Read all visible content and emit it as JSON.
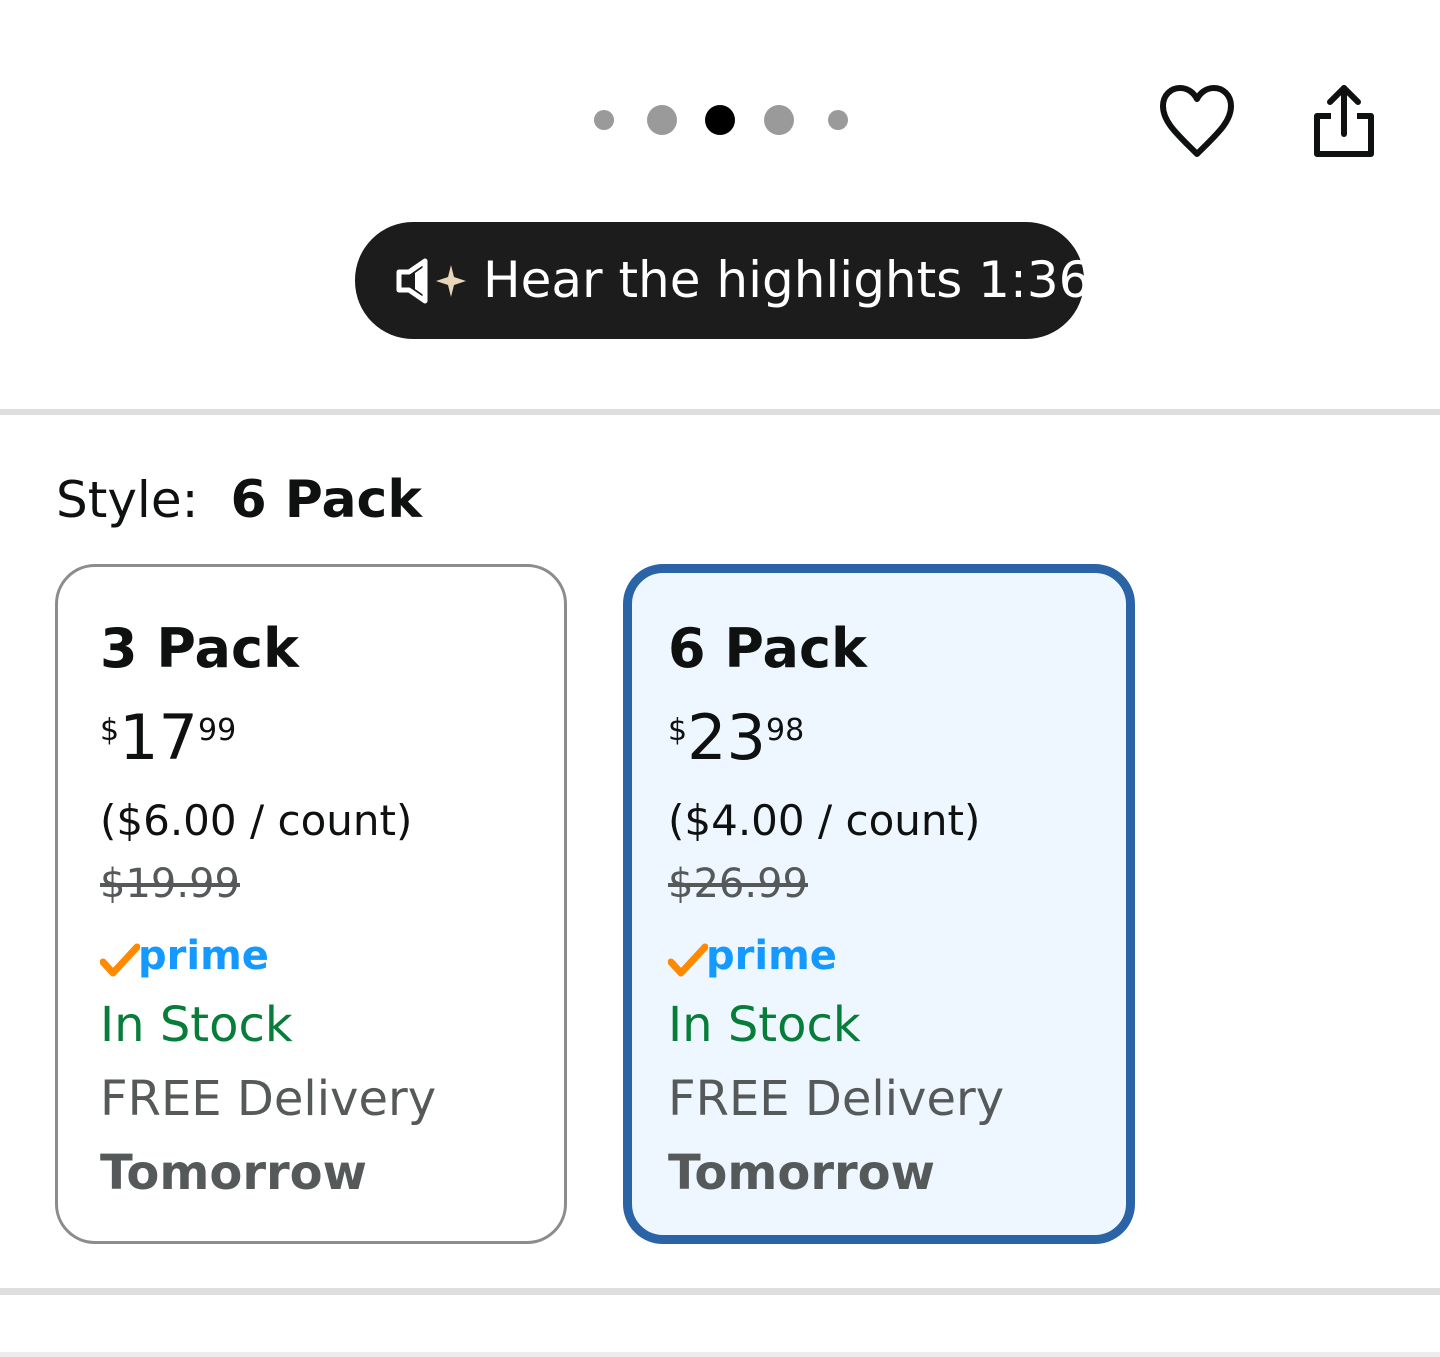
{
  "carousel": {
    "dot_count": 5,
    "active_index": 2
  },
  "header_icons": [
    "heart-icon",
    "share-icon"
  ],
  "hear_highlights": {
    "icon": "speaker-sparkle-icon",
    "label": "Hear the highlights 1:36"
  },
  "style": {
    "label": "Style:",
    "value": "6 Pack"
  },
  "options": [
    {
      "title": "3 Pack",
      "price_symbol": "$",
      "price_whole": "17",
      "price_fraction": "99",
      "per_count": "($6.00 / count)",
      "list_price": "$19.99",
      "prime_label": "prime",
      "availability": "In Stock",
      "delivery": "FREE Delivery",
      "delivery_day": "Tomorrow",
      "selected": false
    },
    {
      "title": "6 Pack",
      "price_symbol": "$",
      "price_whole": "23",
      "price_fraction": "98",
      "per_count": "($4.00 / count)",
      "list_price": "$26.99",
      "prime_label": "prime",
      "availability": "In Stock",
      "delivery": "FREE Delivery",
      "delivery_day": "Tomorrow",
      "selected": true
    }
  ],
  "colors": {
    "selected_border": "#2a64a6",
    "selected_bg": "#eef7ff",
    "in_stock": "#067d39",
    "prime_blue": "#1399ff",
    "prime_check": "#ff8a00"
  }
}
